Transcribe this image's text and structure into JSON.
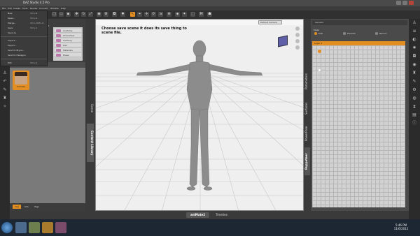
{
  "app": {
    "title": "DAZ Studio 4.5 Pro"
  },
  "menubar": {
    "items": [
      "File",
      "Edit",
      "Create",
      "Tools",
      "Render",
      "Connect",
      "Window",
      "Help"
    ]
  },
  "file_menu": {
    "items": [
      {
        "label": "New",
        "shortcut": "Ctrl+N"
      },
      {
        "label": "Open...",
        "shortcut": "Ctrl+O"
      },
      {
        "label": "Merge...",
        "shortcut": "Ctrl+Shift+O"
      },
      {
        "label": "Save",
        "shortcut": "Ctrl+S"
      },
      {
        "label": "Save As",
        "shortcut": ""
      },
      {
        "label": "Import...",
        "shortcut": ""
      },
      {
        "label": "Export...",
        "shortcut": ""
      },
      {
        "label": "Send to Bryce...",
        "shortcut": ""
      },
      {
        "label": "Send to Hexagon",
        "shortcut": ""
      },
      {
        "label": "Exit",
        "shortcut": "Ctrl+Q"
      }
    ]
  },
  "content_library": {
    "categories": [
      "Anatomy",
      "Characters",
      "Clothing",
      "Hair",
      "Materials",
      "Poses"
    ],
    "thumbnail_label": "Genesis",
    "tabs": [
      "Tips",
      "Info",
      "Tags"
    ],
    "selected_tab": "Tips",
    "page_info": "1 of 1"
  },
  "left_vertical_tabs": [
    "Scene",
    "Content Library"
  ],
  "viewport": {
    "camera": "Default Camera",
    "annotation": "Choose save scene it does its save thing to scene file."
  },
  "right_vertical_tabs": [
    "Parameters",
    "Surfaces",
    "PowerPose",
    "Puppeteer"
  ],
  "puppeteer": {
    "header": "Genesis",
    "mode_label": "Mode",
    "options": [
      "Edit",
      "Preview",
      "Record"
    ],
    "layer": "Layer 1"
  },
  "bottom_tabs": [
    "aniMate2",
    "Timeline"
  ],
  "taskbar": {
    "time": "5:46 PM",
    "date": "11/6/2012"
  },
  "colors": {
    "accent": "#e38e22",
    "panel": "#4a4a4a",
    "viewport_bg": "#efefef"
  }
}
